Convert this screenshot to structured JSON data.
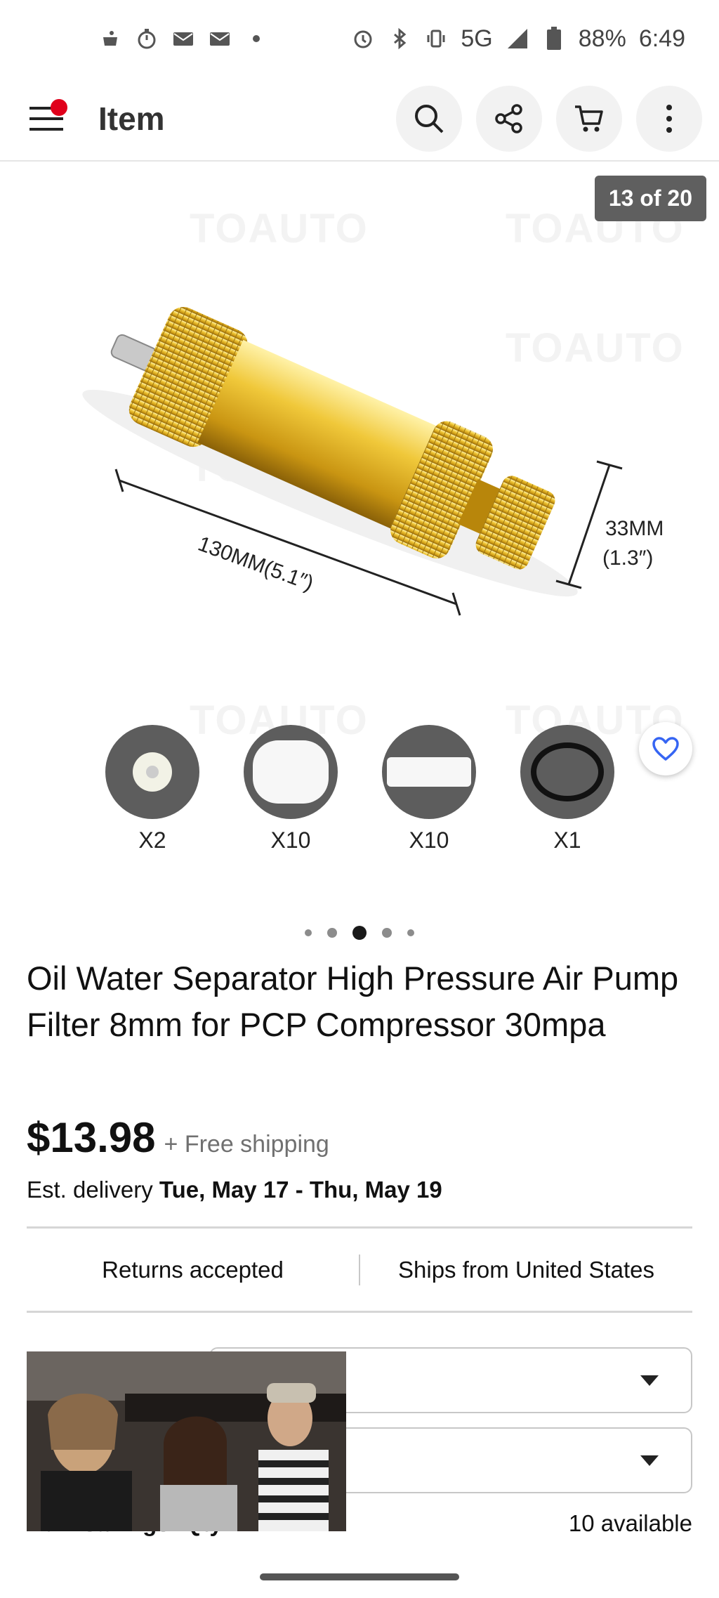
{
  "status_bar": {
    "network": "5G",
    "battery": "88%",
    "time": "6:49"
  },
  "app_bar": {
    "title": "Item"
  },
  "gallery": {
    "counter": "13 of 20",
    "watermark": "TOAUTO",
    "dimension_length": "130MM(5.1″)",
    "dimension_width_mm": "33MM",
    "dimension_width_in": "(1.3″)",
    "accessories": [
      {
        "label": "X2"
      },
      {
        "label": "X10"
      },
      {
        "label": "X10"
      },
      {
        "label": "X1"
      }
    ],
    "page_dots": 5,
    "active_dot": 2
  },
  "listing": {
    "title": "Oil Water Separator High Pressure Air Pump Filter 8mm for PCP Compressor 30mpa",
    "price": "$13.98",
    "shipping": "+ Free shipping",
    "delivery_label": "Est. delivery",
    "delivery_dates": "Tue, May 17 - Thu, May 19",
    "returns": "Returns accepted",
    "ships_from": "Ships from United States",
    "bulk_label": "Bulk savings: Qty 1",
    "availability": "10 available"
  },
  "colors": {
    "brand_red": "#e0001b",
    "favorite_blue": "#3665f3",
    "gold": "#d8a821"
  }
}
